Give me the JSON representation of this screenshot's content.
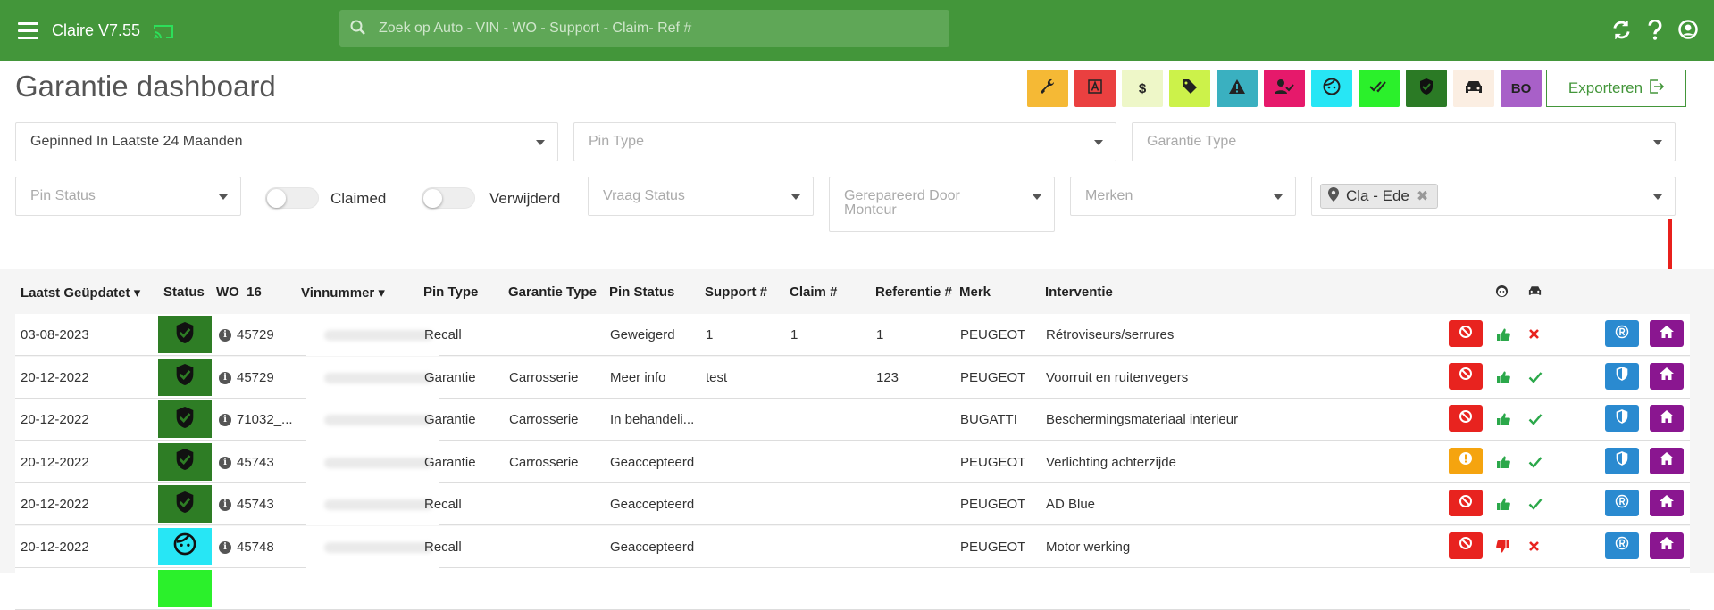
{
  "app": {
    "title": "Claire V7.55"
  },
  "search": {
    "placeholder": "Zoek op Auto - VIN - WO - Support - Claim- Ref #"
  },
  "page": {
    "title": "Garantie dashboard"
  },
  "quick_filters": [
    {
      "icon": "wrench-icon",
      "label": "",
      "color": "#f5b935"
    },
    {
      "icon": "letter-a-icon",
      "label": "",
      "color": "#ea4040"
    },
    {
      "icon": "dollar-icon",
      "label": "$",
      "color": "#eef7c8"
    },
    {
      "icon": "tag-icon",
      "label": "",
      "color": "#ccf24a"
    },
    {
      "icon": "warning-icon",
      "label": "",
      "color": "#3ab0c0"
    },
    {
      "icon": "user-check-icon",
      "label": "",
      "color": "#e6196b"
    },
    {
      "icon": "face-icon",
      "label": "",
      "color": "#27e6f5"
    },
    {
      "icon": "double-check-icon",
      "label": "",
      "color": "#2bf02b"
    },
    {
      "icon": "shield-icon",
      "label": "",
      "color": "#2b7a25"
    },
    {
      "icon": "car-icon",
      "label": "",
      "color": "#fbeee2"
    },
    {
      "icon": "bo-icon",
      "label": "BO",
      "color": "#a860c8"
    }
  ],
  "export": {
    "label": "Exporteren"
  },
  "filters": {
    "pinned": "Gepinned In Laatste 24 Maanden",
    "pin_type": "Pin Type",
    "garantie_type": "Garantie Type",
    "pin_status": "Pin Status",
    "claimed_label": "Claimed",
    "verwijderd_label": "Verwijderd",
    "vraag_status": "Vraag Status",
    "gerepareerd_line1": "Gerepareerd Door",
    "gerepareerd_line2": "Monteur",
    "merken": "Merken",
    "location_chip": "Cla - Ede"
  },
  "table": {
    "headers": {
      "updated": "Laatst Geüpdatet",
      "status": "Status",
      "wo": "WO",
      "wo_count": "16",
      "vin": "Vinnummer",
      "pin_type": "Pin Type",
      "garantie_type": "Garantie Type",
      "pin_status": "Pin Status",
      "support": "Support #",
      "claim": "Claim #",
      "referentie": "Referentie #",
      "merk": "Merk",
      "interventie": "Interventie"
    },
    "rows": [
      {
        "date": "03-08-2023",
        "status": "shield",
        "wo": "45729",
        "pin_type": "Recall",
        "garantie_type": "",
        "pin_status": "Geweigerd",
        "support": "1",
        "claim": "1",
        "ref": "1",
        "merk": "PEUGEOT",
        "interventie": "Rétroviseurs/serrures",
        "a1": "ban",
        "thumb": "up",
        "check": "x",
        "b1": "registered"
      },
      {
        "date": "20-12-2022",
        "status": "shield",
        "wo": "45729",
        "pin_type": "Garantie",
        "garantie_type": "Carrosserie",
        "pin_status": "Meer info",
        "support": "test",
        "claim": "",
        "ref": "123",
        "merk": "PEUGEOT",
        "interventie": "Voorruit en ruitenvegers",
        "a1": "ban",
        "thumb": "up",
        "check": "check",
        "b1": "shield"
      },
      {
        "date": "20-12-2022",
        "status": "shield",
        "wo": "71032_...",
        "pin_type": "Garantie",
        "garantie_type": "Carrosserie",
        "pin_status": "In behandeli...",
        "support": "",
        "claim": "",
        "ref": "",
        "merk": "BUGATTI",
        "interventie": "Beschermingsmateriaal interieur",
        "a1": "ban",
        "thumb": "up",
        "check": "check",
        "b1": "shield"
      },
      {
        "date": "20-12-2022",
        "status": "shield",
        "wo": "45743",
        "pin_type": "Garantie",
        "garantie_type": "Carrosserie",
        "pin_status": "Geaccepteerd",
        "support": "",
        "claim": "",
        "ref": "",
        "merk": "PEUGEOT",
        "interventie": "Verlichting achterzijde",
        "a1": "warn",
        "thumb": "up",
        "check": "check",
        "b1": "shield"
      },
      {
        "date": "20-12-2022",
        "status": "shield",
        "wo": "45743",
        "pin_type": "Recall",
        "garantie_type": "",
        "pin_status": "Geaccepteerd",
        "support": "",
        "claim": "",
        "ref": "",
        "merk": "PEUGEOT",
        "interventie": "AD Blue",
        "a1": "ban",
        "thumb": "up",
        "check": "check",
        "b1": "registered"
      },
      {
        "date": "20-12-2022",
        "status": "face",
        "wo": "45748",
        "pin_type": "Recall",
        "garantie_type": "",
        "pin_status": "Geaccepteerd",
        "support": "",
        "claim": "",
        "ref": "",
        "merk": "PEUGEOT",
        "interventie": "Motor werking",
        "a1": "ban",
        "thumb": "down",
        "check": "x",
        "b1": "registered"
      }
    ]
  },
  "colors": {
    "brand_green": "#43963a",
    "red": "#e8231f",
    "orange": "#f5a40f",
    "blue": "#2a8ad0",
    "purple": "#8a1690"
  }
}
